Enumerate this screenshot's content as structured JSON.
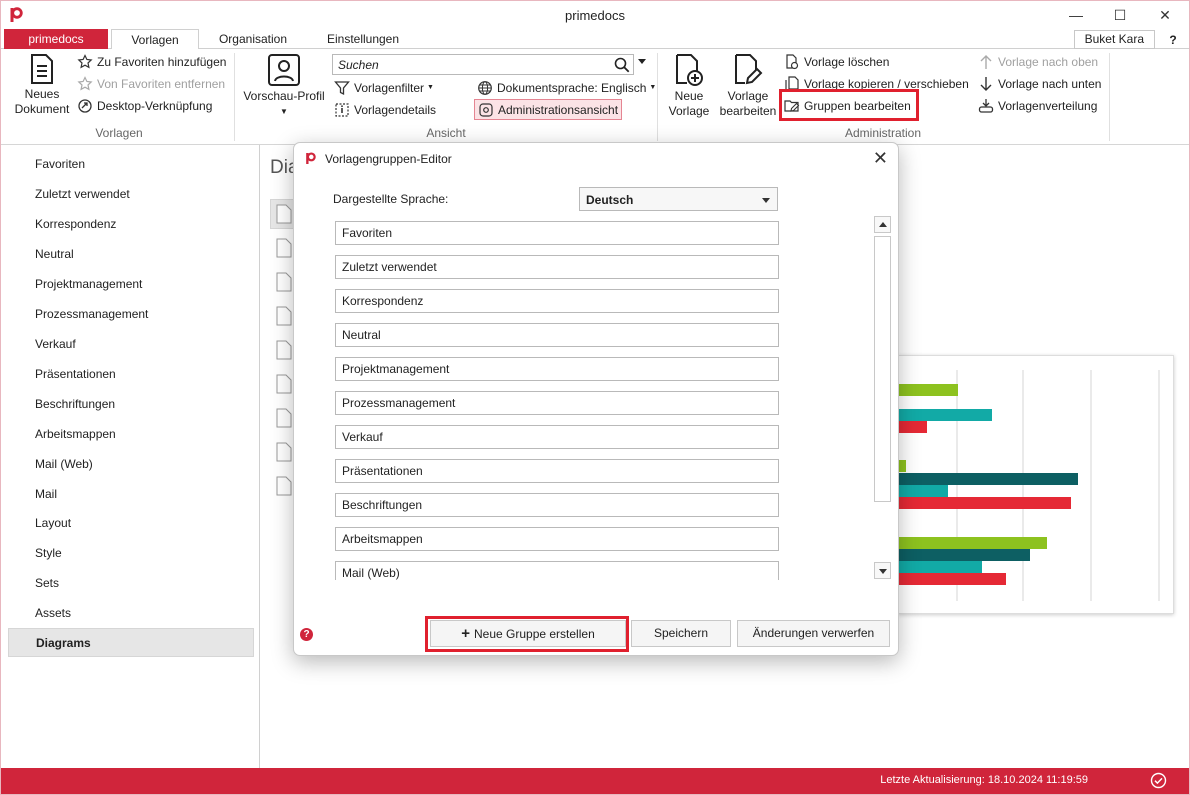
{
  "window": {
    "title": "primedocs",
    "minimize": "—",
    "maximize": "☐",
    "close": "✕"
  },
  "tabs": {
    "brand": "primedocs",
    "vorlagen": "Vorlagen",
    "organisation": "Organisation",
    "einstellungen": "Einstellungen"
  },
  "user": {
    "name": "Buket Kara",
    "help": "?"
  },
  "ribbon": {
    "vorlagen_group": {
      "label": "Vorlagen",
      "neues_dokument": [
        "Neues",
        "Dokument"
      ],
      "add_favorites": "Zu Favoriten hinzufügen",
      "remove_favorites": "Von Favoriten entfernen",
      "desktop_link": "Desktop-Verknüpfung"
    },
    "ansicht_group": {
      "label": "Ansicht",
      "preview_profile": "Vorschau-Profil",
      "search_placeholder": "Suchen",
      "template_filter": "Vorlagenfilter",
      "template_details": "Vorlagendetails",
      "doc_language": "Dokumentsprache: Englisch",
      "admin_view": "Administrationsansicht"
    },
    "admin_group": {
      "label": "Administration",
      "new_template": [
        "Neue",
        "Vorlage"
      ],
      "edit_template": [
        "Vorlage",
        "bearbeiten"
      ],
      "delete_template": "Vorlage löschen",
      "copy_move_template": "Vorlage kopieren / verschieben",
      "edit_groups": "Gruppen bearbeiten",
      "move_up": "Vorlage nach oben",
      "move_down": "Vorlage nach unten",
      "distribution": "Vorlagenverteilung"
    }
  },
  "sidebar": {
    "items": [
      "Favoriten",
      "Zuletzt verwendet",
      "Korrespondenz",
      "Neutral",
      "Projektmanagement",
      "Prozessmanagement",
      "Verkauf",
      "Präsentationen",
      "Beschriftungen",
      "Arbeitsmappen",
      "Mail (Web)",
      "Mail",
      "Layout",
      "Style",
      "Sets",
      "Assets",
      "Diagrams"
    ],
    "selected": "Diagrams"
  },
  "main": {
    "title_partial": "Dia"
  },
  "dialog": {
    "title": "Vorlagengruppen-Editor",
    "language_label": "Dargestellte Sprache:",
    "language_value": "Deutsch",
    "groups": [
      "Favoriten",
      "Zuletzt verwendet",
      "Korrespondenz",
      "Neutral",
      "Projektmanagement",
      "Prozessmanagement",
      "Verkauf",
      "Präsentationen",
      "Beschriftungen",
      "Arbeitsmappen",
      "Mail (Web)"
    ],
    "new_group_button": "Neue Gruppe erstellen",
    "save_button": "Speichern",
    "discard_button": "Änderungen verwerfen"
  },
  "status": {
    "last_update": "Letzte Aktualisierung: 18.10.2024 11:19:59"
  },
  "colors": {
    "brand": "#d0253b",
    "highlight": "#e0202e",
    "chart_green": "#8dc21f",
    "chart_teal": "#12aaa6",
    "chart_dark_teal": "#0d5f63",
    "chart_red": "#e52935"
  }
}
